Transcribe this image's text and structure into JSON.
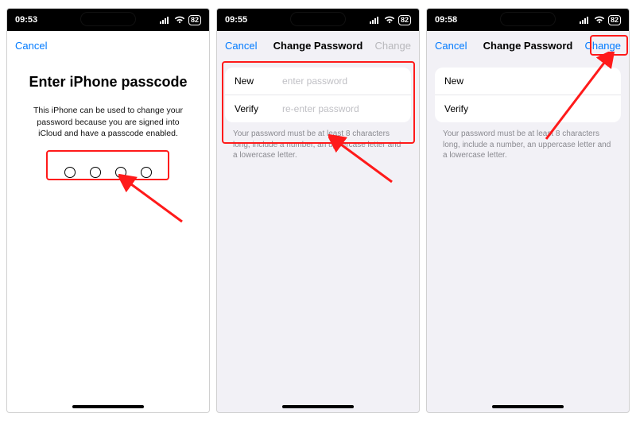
{
  "screens": [
    {
      "status": {
        "time": "09:53",
        "battery": "82"
      },
      "nav": {
        "cancel": "Cancel"
      },
      "title": "Enter iPhone passcode",
      "desc": "This iPhone can be used to change your password because you are signed into iCloud and have a passcode enabled.",
      "passcode_count": 4
    },
    {
      "status": {
        "time": "09:55",
        "battery": "82"
      },
      "nav": {
        "cancel": "Cancel",
        "title": "Change Password",
        "action": "Change",
        "action_enabled": false
      },
      "fields": {
        "new_label": "New",
        "new_placeholder": "enter password",
        "verify_label": "Verify",
        "verify_placeholder": "re-enter password"
      },
      "hint": "Your password must be at least 8 characters long, include a number, an uppercase letter and a lowercase letter."
    },
    {
      "status": {
        "time": "09:58",
        "battery": "82"
      },
      "nav": {
        "cancel": "Cancel",
        "title": "Change Password",
        "action": "Change",
        "action_enabled": true
      },
      "fields": {
        "new_label": "New",
        "new_placeholder": "",
        "verify_label": "Verify",
        "verify_placeholder": ""
      },
      "hint": "Your password must be at least 8 characters long, include a number, an uppercase letter and a lowercase letter."
    }
  ],
  "colors": {
    "accent": "#007aff",
    "highlight": "#ff1a1a"
  }
}
